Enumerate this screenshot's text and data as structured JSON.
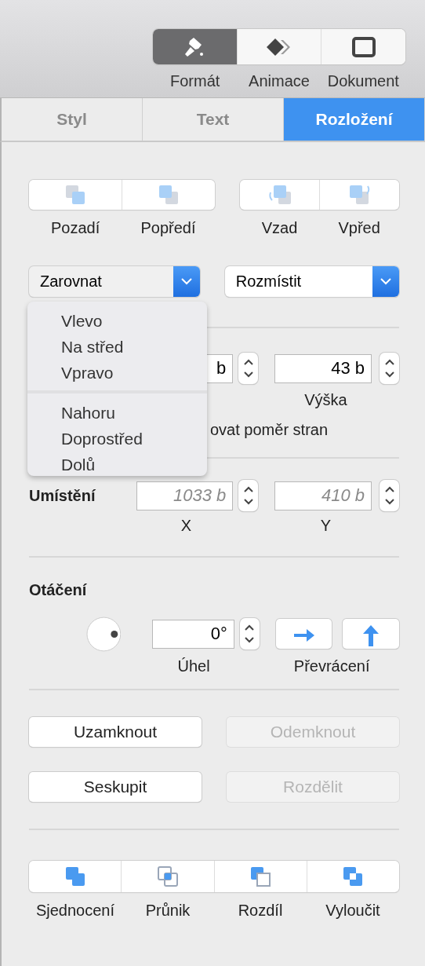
{
  "toolbar": {
    "buttons": [
      {
        "label": "Formát",
        "kind": "brush",
        "selected": true
      },
      {
        "label": "Animace",
        "kind": "diamond",
        "selected": false
      },
      {
        "label": "Dokument",
        "kind": "window",
        "selected": false
      }
    ]
  },
  "tabs": [
    {
      "label": "Styl",
      "selected": false
    },
    {
      "label": "Text",
      "selected": false
    },
    {
      "label": "Rozložení",
      "selected": true
    }
  ],
  "arrange": [
    [
      {
        "label": "Pozadí",
        "kind": "back"
      },
      {
        "label": "Popředí",
        "kind": "front"
      }
    ],
    [
      {
        "label": "Vzad",
        "kind": "backward"
      },
      {
        "label": "Vpřed",
        "kind": "forward"
      }
    ]
  ],
  "popups": [
    {
      "value": "Zarovnat",
      "expanded": true
    },
    {
      "value": "Rozmístit",
      "expanded": false
    }
  ],
  "align_menu": [
    [
      "Vlevo",
      "Na střed",
      "Vpravo"
    ],
    [
      "Nahoru",
      "Doprostřed",
      "Dolů"
    ]
  ],
  "size": {
    "width_value": "b",
    "height_value": "43 b",
    "height_label": "Výška",
    "constrain_label": "ovat poměr stran"
  },
  "position": {
    "label": "Umístění",
    "x_placeholder": "1033 b",
    "y_placeholder": "410 b",
    "x_label": "X",
    "y_label": "Y"
  },
  "rotation": {
    "title": "Otáčení",
    "angle_value": "0°",
    "angle_label": "Úhel",
    "flip_label": "Převrácení"
  },
  "lock_buttons": [
    {
      "label": "Uzamknout",
      "disabled": false
    },
    {
      "label": "Odemknout",
      "disabled": true
    },
    {
      "label": "Seskupit",
      "disabled": false
    },
    {
      "label": "Rozdělit",
      "disabled": true
    }
  ],
  "combine": [
    {
      "label": "Sjednocení",
      "kind": "union"
    },
    {
      "label": "Průnik",
      "kind": "intersect"
    },
    {
      "label": "Rozdíl",
      "kind": "subtract"
    },
    {
      "label": "Vyloučit",
      "kind": "exclude"
    }
  ]
}
